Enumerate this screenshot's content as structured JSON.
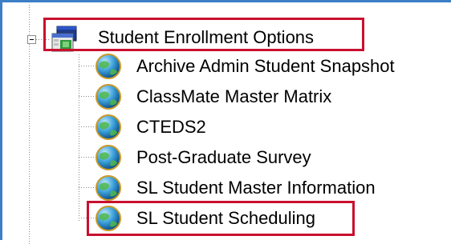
{
  "tree": {
    "parent": {
      "label": "Student Enrollment Options",
      "icon": "window-folder-icon",
      "expanded": true,
      "expander_symbol": "−"
    },
    "children": [
      {
        "label": "Archive Admin Student Snapshot",
        "icon": "globe-icon"
      },
      {
        "label": "ClassMate Master Matrix",
        "icon": "globe-icon"
      },
      {
        "label": "CTEDS2",
        "icon": "globe-icon"
      },
      {
        "label": "Post-Graduate Survey",
        "icon": "globe-icon"
      },
      {
        "label": "SL Student Master Information",
        "icon": "globe-icon"
      },
      {
        "label": "SL Student Scheduling",
        "icon": "globe-icon"
      }
    ]
  },
  "colors": {
    "highlight": "#c8102e",
    "frame": "#3c7fc7",
    "connector": "#8a8a8a"
  }
}
